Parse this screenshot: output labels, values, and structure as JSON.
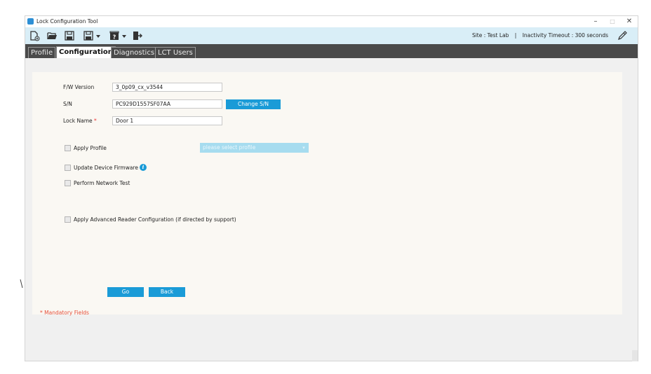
{
  "window": {
    "title": "Lock Configuration Tool",
    "controls": {
      "minimize": "–",
      "maximize": "□",
      "close": "✕"
    }
  },
  "toolbar": {
    "icons": [
      "new-file-icon",
      "open-folder-icon",
      "save-icon",
      "save-as-icon",
      "help-icon",
      "exit-icon"
    ],
    "site_label": "Site",
    "site_value": "Test Lab",
    "separator": "|",
    "timeout_label": "Inactivity Timeout",
    "timeout_value": "300 seconds",
    "edit_icon": "pencil-icon"
  },
  "tabs": [
    {
      "label": "Profile",
      "active": false
    },
    {
      "label": "Configuration",
      "active": true
    },
    {
      "label": "Diagnostics",
      "active": false
    },
    {
      "label": "LCT Users",
      "active": false
    }
  ],
  "form": {
    "fw_version_label": "F/W Version",
    "fw_version_value": "3_0p09_cx_v3544",
    "sn_label": "S/N",
    "sn_value": "PC929D1557SF07AA",
    "change_sn_button": "Change S/N",
    "lock_name_label": "Lock Name",
    "required_marker": "*",
    "lock_name_value": "Door 1",
    "apply_profile_label": "Apply Profile",
    "apply_profile_checked": false,
    "profile_select_placeholder": "please select profile",
    "update_firmware_label": "Update Device Firmware",
    "update_firmware_checked": false,
    "info_icon": "i",
    "network_test_label": "Perform Network Test",
    "network_test_checked": false,
    "advanced_reader_label": "Apply Advanced Reader Configuration (if directed by support)",
    "advanced_reader_checked": false,
    "go_button": "Go",
    "back_button": "Back",
    "mandatory_note": "* Mandatory Fields"
  },
  "colors": {
    "accent": "#1a9bd7",
    "toolbar_bg": "#d9eef7",
    "tabbar_bg": "#4a4a4a",
    "panel_bg": "#faf8f3",
    "mandatory": "#e6503c"
  }
}
